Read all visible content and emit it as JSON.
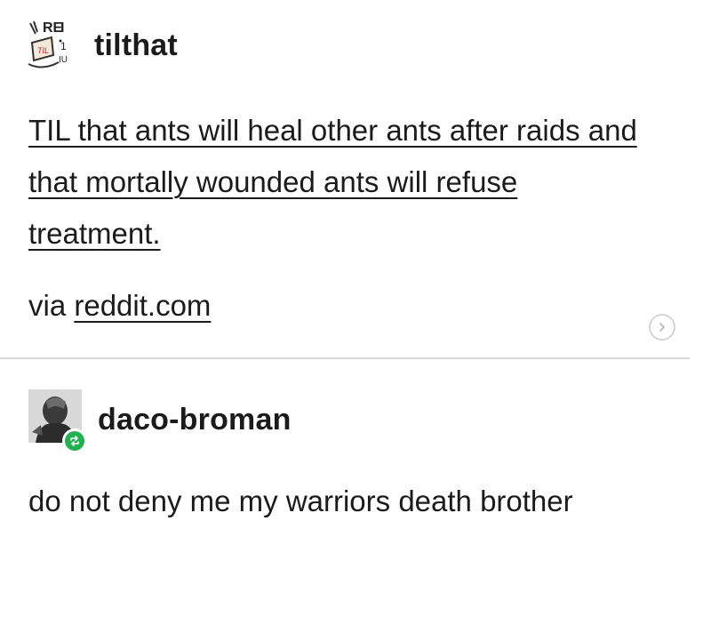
{
  "post": {
    "author": "tilthat",
    "avatar_icon": "til-logo-icon",
    "title": "TIL that ants will heal other ants after raids and that mortally wounded ants will refuse treatment.",
    "via_prefix": "via",
    "via_link": "reddit.com",
    "arrow_icon": "chevron-right-icon"
  },
  "reblog": {
    "author": "daco-broman",
    "avatar_icon": "user-avatar-icon",
    "badge_icon": "reblog-icon",
    "badge_color": "#21b152",
    "text": "do not deny me my warriors death brother"
  }
}
